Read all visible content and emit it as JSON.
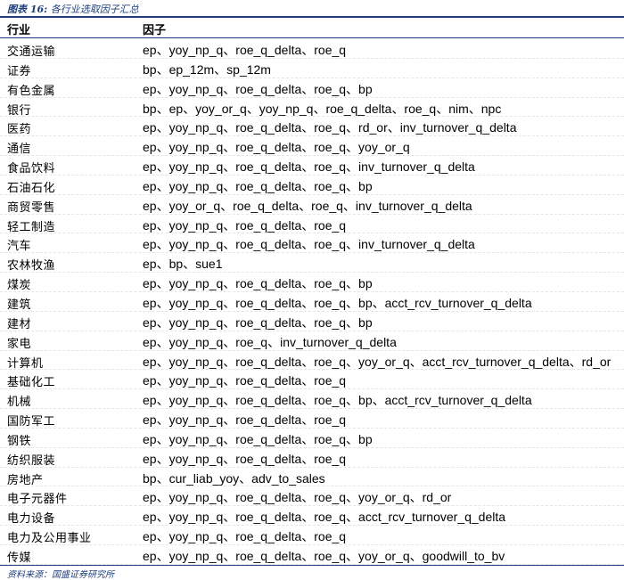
{
  "caption": {
    "label": "图表 16:",
    "title": "各行业选取因子汇总"
  },
  "table": {
    "headers": {
      "industry": "行业",
      "factors": "因子"
    },
    "rows": [
      {
        "industry": "交通运输",
        "factors": "ep、yoy_np_q、roe_q_delta、roe_q"
      },
      {
        "industry": "证券",
        "factors": "bp、ep_12m、sp_12m"
      },
      {
        "industry": "有色金属",
        "factors": "ep、yoy_np_q、roe_q_delta、roe_q、bp"
      },
      {
        "industry": "银行",
        "factors": "bp、ep、yoy_or_q、yoy_np_q、roe_q_delta、roe_q、nim、npc"
      },
      {
        "industry": "医药",
        "factors": "ep、yoy_np_q、roe_q_delta、roe_q、rd_or、inv_turnover_q_delta"
      },
      {
        "industry": "通信",
        "factors": "ep、yoy_np_q、roe_q_delta、roe_q、yoy_or_q"
      },
      {
        "industry": "食品饮料",
        "factors": "ep、yoy_np_q、roe_q_delta、roe_q、inv_turnover_q_delta"
      },
      {
        "industry": "石油石化",
        "factors": "ep、yoy_np_q、roe_q_delta、roe_q、bp"
      },
      {
        "industry": "商贸零售",
        "factors": "ep、yoy_or_q、roe_q_delta、roe_q、inv_turnover_q_delta"
      },
      {
        "industry": "轻工制造",
        "factors": "ep、yoy_np_q、roe_q_delta、roe_q"
      },
      {
        "industry": "汽车",
        "factors": "ep、yoy_np_q、roe_q_delta、roe_q、inv_turnover_q_delta"
      },
      {
        "industry": "农林牧渔",
        "factors": "ep、bp、sue1"
      },
      {
        "industry": "煤炭",
        "factors": "ep、yoy_np_q、roe_q_delta、roe_q、bp"
      },
      {
        "industry": "建筑",
        "factors": "ep、yoy_np_q、roe_q_delta、roe_q、bp、acct_rcv_turnover_q_delta"
      },
      {
        "industry": "建材",
        "factors": "ep、yoy_np_q、roe_q_delta、roe_q、bp"
      },
      {
        "industry": "家电",
        "factors": "ep、yoy_np_q、roe_q、inv_turnover_q_delta"
      },
      {
        "industry": "计算机",
        "factors": "ep、yoy_np_q、roe_q_delta、roe_q、yoy_or_q、acct_rcv_turnover_q_delta、rd_or"
      },
      {
        "industry": "基础化工",
        "factors": "ep、yoy_np_q、roe_q_delta、roe_q"
      },
      {
        "industry": "机械",
        "factors": "ep、yoy_np_q、roe_q_delta、roe_q、bp、acct_rcv_turnover_q_delta"
      },
      {
        "industry": "国防军工",
        "factors": "ep、yoy_np_q、roe_q_delta、roe_q"
      },
      {
        "industry": "钢铁",
        "factors": "ep、yoy_np_q、roe_q_delta、roe_q、bp"
      },
      {
        "industry": "纺织服装",
        "factors": "ep、yoy_np_q、roe_q_delta、roe_q"
      },
      {
        "industry": "房地产",
        "factors": "bp、cur_liab_yoy、adv_to_sales"
      },
      {
        "industry": "电子元器件",
        "factors": "ep、yoy_np_q、roe_q_delta、roe_q、yoy_or_q、rd_or"
      },
      {
        "industry": "电力设备",
        "factors": "ep、yoy_np_q、roe_q_delta、roe_q、acct_rcv_turnover_q_delta"
      },
      {
        "industry": "电力及公用事业",
        "factors": "ep、yoy_np_q、roe_q_delta、roe_q"
      },
      {
        "industry": "传媒",
        "factors": "ep、yoy_np_q、roe_q_delta、roe_q、yoy_or_q、goodwill_to_bv"
      }
    ]
  },
  "source": "资料来源：国盛证券研究所"
}
